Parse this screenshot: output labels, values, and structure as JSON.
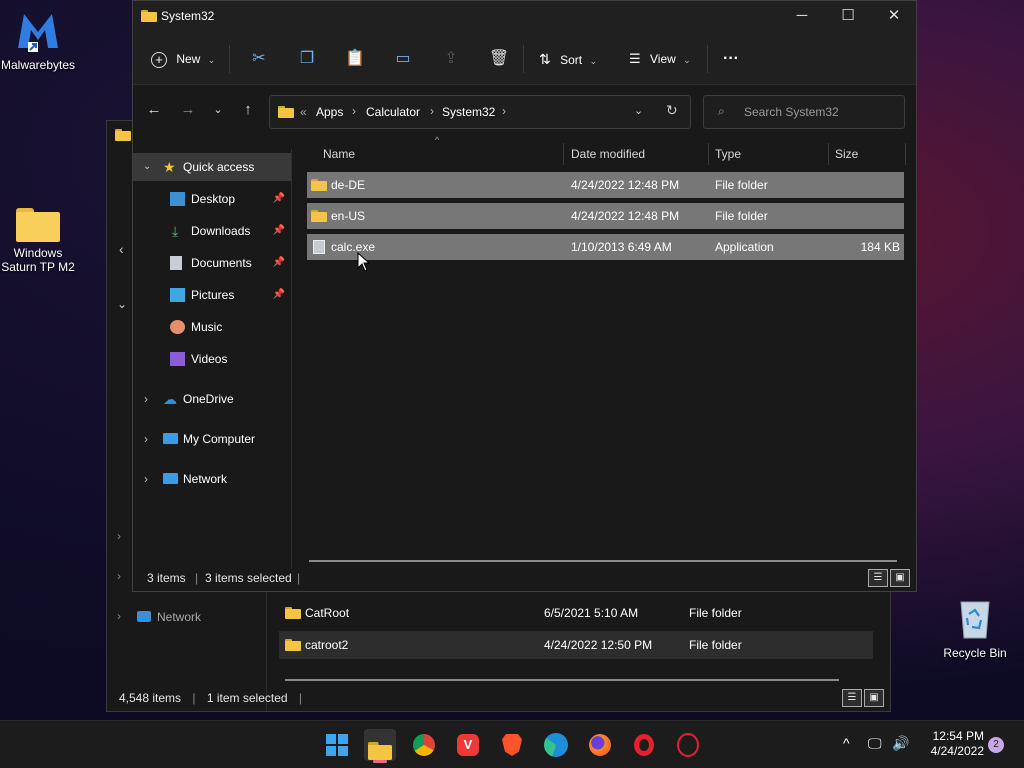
{
  "desktop": {
    "icons": [
      {
        "label": "Malwarebytes"
      },
      {
        "label": "Windows Saturn TP M2"
      },
      {
        "label": "Recycle Bin"
      }
    ]
  },
  "back_window": {
    "nav_item": "Network",
    "rows": [
      {
        "name": "CatRoot",
        "date": "6/5/2021 5:10 AM",
        "type": "File folder"
      },
      {
        "name": "catroot2",
        "date": "4/24/2022 12:50 PM",
        "type": "File folder"
      }
    ],
    "status": {
      "items": "4,548 items",
      "selected": "1 item selected"
    }
  },
  "main_window": {
    "title": "System32",
    "toolbar": {
      "new_label": "New",
      "sort_label": "Sort",
      "view_label": "View",
      "more_label": "···"
    },
    "address": {
      "overflow": "«",
      "crumbs": [
        "Apps",
        "Calculator",
        "System32"
      ]
    },
    "search_placeholder": "Search System32",
    "nav": {
      "quick_access": "Quick access",
      "items": [
        {
          "label": "Desktop",
          "pinned": true
        },
        {
          "label": "Downloads",
          "pinned": true
        },
        {
          "label": "Documents",
          "pinned": true
        },
        {
          "label": "Pictures",
          "pinned": true
        },
        {
          "label": "Music",
          "pinned": false
        },
        {
          "label": "Videos",
          "pinned": false
        }
      ],
      "onedrive": "OneDrive",
      "my_computer": "My Computer",
      "network": "Network"
    },
    "columns": {
      "name": "Name",
      "date": "Date modified",
      "type": "Type",
      "size": "Size"
    },
    "files": [
      {
        "name": "de-DE",
        "date": "4/24/2022 12:48 PM",
        "type": "File folder",
        "size": ""
      },
      {
        "name": "en-US",
        "date": "4/24/2022 12:48 PM",
        "type": "File folder",
        "size": ""
      },
      {
        "name": "calc.exe",
        "date": "1/10/2013 6:49 AM",
        "type": "Application",
        "size": "184 KB"
      }
    ],
    "status": {
      "items": "3 items",
      "selected": "3 items selected"
    }
  },
  "taskbar": {
    "time": "12:54 PM",
    "date": "4/24/2022",
    "notification_count": "2"
  }
}
